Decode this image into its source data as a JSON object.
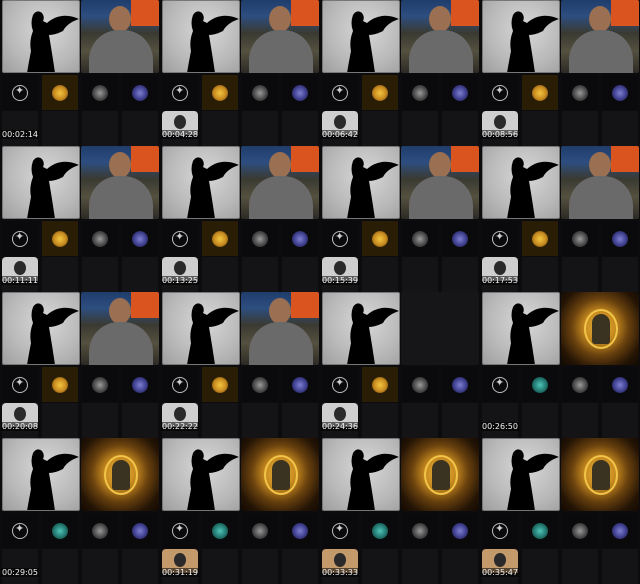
{
  "sheet": {
    "frames": [
      {
        "timestamp": "00:02:14",
        "big_right": "person",
        "strip": [
          "pent",
          "gold",
          "skull",
          "moon"
        ],
        "highlight": 1,
        "avatar": false
      },
      {
        "timestamp": "00:04:28",
        "big_right": "person",
        "strip": [
          "pent",
          "gold",
          "skull",
          "moon"
        ],
        "highlight": 1,
        "avatar": true
      },
      {
        "timestamp": "00:06:42",
        "big_right": "person",
        "strip": [
          "pent",
          "gold",
          "skull",
          "moon"
        ],
        "highlight": 1,
        "avatar": true
      },
      {
        "timestamp": "00:08:56",
        "big_right": "person",
        "strip": [
          "pent",
          "gold",
          "skull",
          "moon"
        ],
        "highlight": 1,
        "avatar": true
      },
      {
        "timestamp": "00:11:11",
        "big_right": "person",
        "strip": [
          "pent",
          "gold",
          "skull",
          "moon"
        ],
        "highlight": 1,
        "avatar": true
      },
      {
        "timestamp": "00:13:25",
        "big_right": "person",
        "strip": [
          "pent",
          "gold",
          "skull",
          "moon"
        ],
        "highlight": 1,
        "avatar": true
      },
      {
        "timestamp": "00:15:39",
        "big_right": "person",
        "strip": [
          "pent",
          "gold",
          "skull",
          "moon"
        ],
        "highlight": 1,
        "avatar": true
      },
      {
        "timestamp": "00:17:53",
        "big_right": "person",
        "strip": [
          "pent",
          "gold",
          "skull",
          "moon"
        ],
        "highlight": 1,
        "avatar": true
      },
      {
        "timestamp": "00:20:08",
        "big_right": "person",
        "strip": [
          "pent",
          "gold",
          "skull",
          "moon"
        ],
        "highlight": 1,
        "avatar": true
      },
      {
        "timestamp": "00:22:22",
        "big_right": "person",
        "strip": [
          "pent",
          "gold",
          "skull",
          "moon"
        ],
        "highlight": 1,
        "avatar": true
      },
      {
        "timestamp": "00:24:36",
        "big_right": "empty",
        "strip": [
          "pent",
          "gold",
          "skull",
          "moon"
        ],
        "highlight": 1,
        "avatar": true
      },
      {
        "timestamp": "00:26:50",
        "big_right": "portrait",
        "strip": [
          "pent",
          "teal",
          "skull",
          "moon"
        ],
        "highlight": -1,
        "avatar": false
      },
      {
        "timestamp": "00:29:05",
        "big_right": "portrait",
        "strip": [
          "pent",
          "teal",
          "skull",
          "moon"
        ],
        "highlight": -1,
        "avatar": false
      },
      {
        "timestamp": "00:31:19",
        "big_right": "portrait",
        "strip": [
          "pent",
          "teal",
          "skull",
          "moon"
        ],
        "highlight": -1,
        "avatar": true
      },
      {
        "timestamp": "00:33:33",
        "big_right": "portrait",
        "strip": [
          "pent",
          "teal",
          "skull",
          "moon"
        ],
        "highlight": -1,
        "avatar": true
      },
      {
        "timestamp": "00:35:47",
        "big_right": "portrait",
        "strip": [
          "pent",
          "teal",
          "skull",
          "moon"
        ],
        "highlight": -1,
        "avatar": true
      }
    ]
  }
}
